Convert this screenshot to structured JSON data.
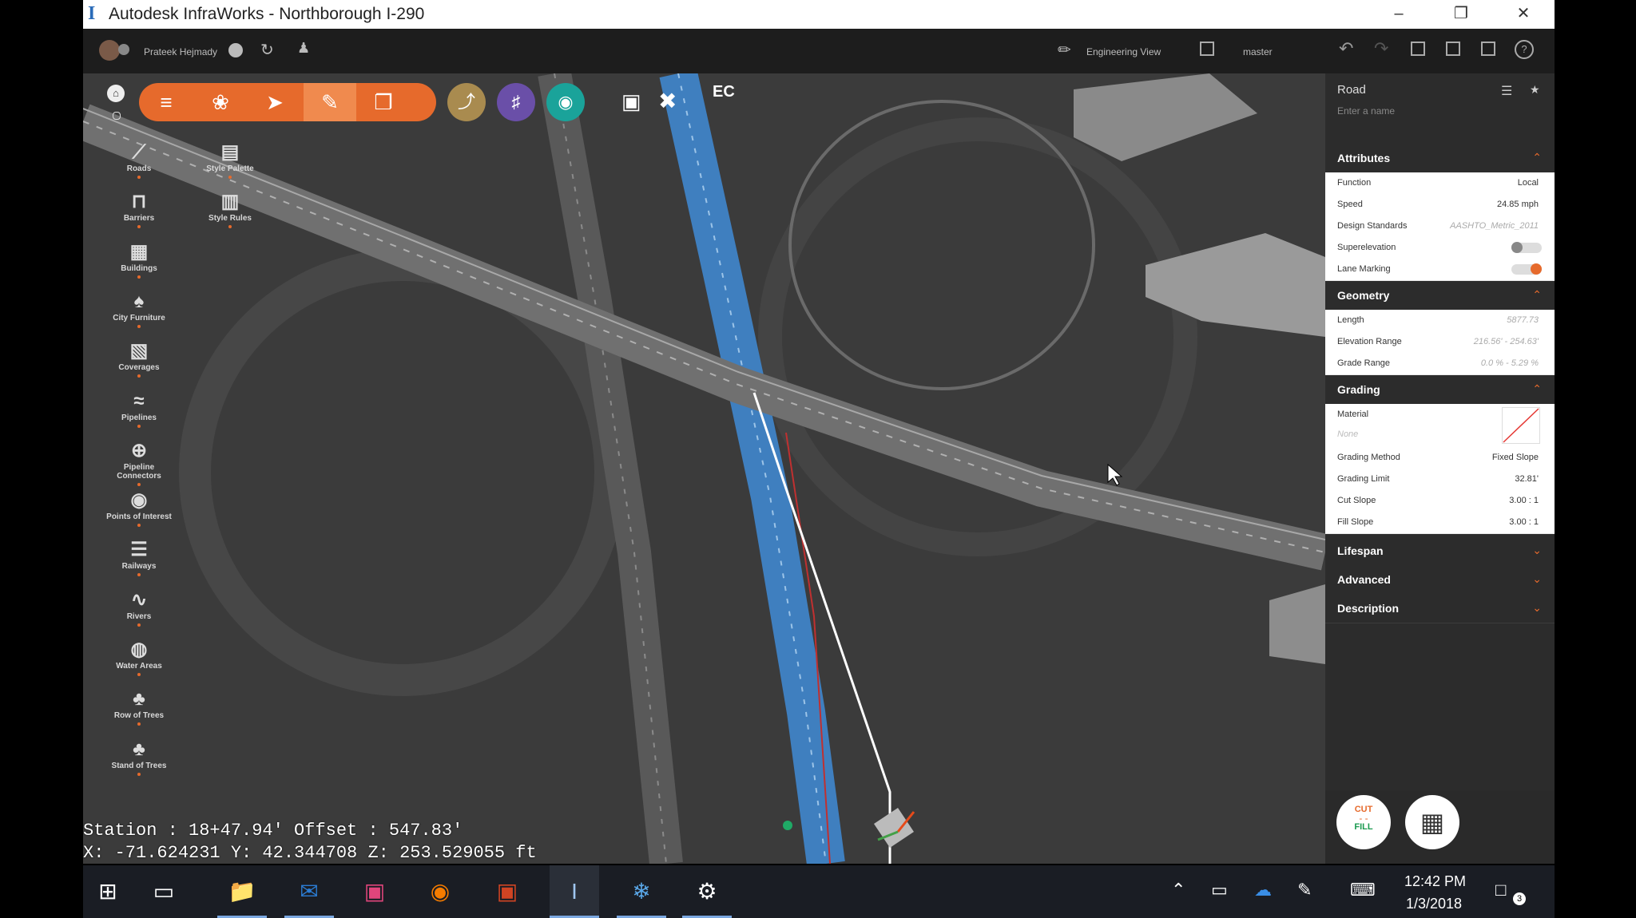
{
  "window": {
    "title": "Autodesk InfraWorks - Northborough I-290",
    "app_icon": "I"
  },
  "appbar": {
    "user_name": "Prateek Hejmady",
    "view_label": "Engineering View",
    "branch_label": "master"
  },
  "toolbar": {
    "ec_label": "EC"
  },
  "palette": {
    "left": [
      {
        "label": "Roads",
        "icon": "roads-icon"
      },
      {
        "label": "Barriers",
        "icon": "barriers-icon"
      },
      {
        "label": "Buildings",
        "icon": "buildings-icon"
      },
      {
        "label": "City Furniture",
        "icon": "city-furniture-icon"
      },
      {
        "label": "Coverages",
        "icon": "coverages-icon"
      },
      {
        "label": "Pipelines",
        "icon": "pipelines-icon"
      },
      {
        "label": "Pipeline Connectors",
        "icon": "pipeline-connectors-icon"
      },
      {
        "label": "Points of Interest",
        "icon": "points-of-interest-icon"
      },
      {
        "label": "Railways",
        "icon": "railways-icon"
      },
      {
        "label": "Rivers",
        "icon": "rivers-icon"
      },
      {
        "label": "Water Areas",
        "icon": "water-areas-icon"
      },
      {
        "label": "Row of Trees",
        "icon": "row-of-trees-icon"
      },
      {
        "label": "Stand of Trees",
        "icon": "stand-of-trees-icon"
      }
    ],
    "right": [
      {
        "label": "Style Palette",
        "icon": "style-palette-icon"
      },
      {
        "label": "Style Rules",
        "icon": "style-rules-icon"
      }
    ]
  },
  "panel": {
    "title": "Road",
    "name_placeholder": "Enter a name",
    "attributes": {
      "header": "Attributes",
      "function_label": "Function",
      "function_value": "Local",
      "speed_label": "Speed",
      "speed_value": "24.85 mph",
      "design_label": "Design Standards",
      "design_value": "AASHTO_Metric_2011",
      "super_label": "Superelevation",
      "lane_label": "Lane Marking"
    },
    "geometry": {
      "header": "Geometry",
      "length_label": "Length",
      "length_value": "5877.73",
      "elev_label": "Elevation Range",
      "elev_value": "216.56' - 254.63'",
      "grade_label": "Grade Range",
      "grade_value": "0.0 % - 5.29 %"
    },
    "grading": {
      "header": "Grading",
      "material_label": "Material",
      "material_value": "None",
      "method_label": "Grading Method",
      "method_value": "Fixed Slope",
      "limit_label": "Grading Limit",
      "limit_value": "32.81'",
      "cut_label": "Cut Slope",
      "cut_value": "3.00 : 1",
      "fill_label": "Fill Slope",
      "fill_value": "3.00 : 1"
    },
    "collapsed": {
      "lifespan": "Lifespan",
      "advanced": "Advanced",
      "description": "Description"
    },
    "cutfill": {
      "cut": "CUT",
      "fill": "FILL"
    }
  },
  "status": {
    "line1": "Station : 18+47.94' Offset : 547.83'",
    "line2": "X: -71.624231 Y: 42.344708 Z: 253.529055 ft"
  },
  "taskbar": {
    "time": "12:42 PM",
    "date": "1/3/2018",
    "notification_count": "3"
  },
  "colors": {
    "accent": "#e66a2c",
    "water": "#3f7fbf",
    "panel_bg": "#2c2c2c"
  }
}
